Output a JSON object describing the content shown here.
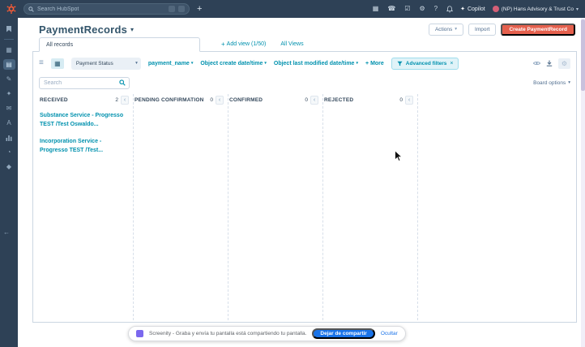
{
  "topbar": {
    "search_placeholder": "Search HubSpot",
    "copilot_label": "Copilot",
    "account_label": "(NP) Hans Advisory & Trust Co"
  },
  "header": {
    "title": "PaymentRecords",
    "actions_label": "Actions",
    "import_label": "Import",
    "create_label": "Create PaymentRecord"
  },
  "views": {
    "active_tab": "All records",
    "add_view_label": "Add view (1/50)",
    "all_views_label": "All Views"
  },
  "toolbar": {
    "pipeline_label": "Payment Status",
    "filter_payment_name": "payment_name",
    "filter_create_date": "Object create date/time",
    "filter_modified_date": "Object last modified date/time",
    "more_label": "More",
    "advanced_filters_label": "Advanced filters"
  },
  "search": {
    "placeholder": "Search"
  },
  "board": {
    "options_label": "Board options",
    "columns": [
      {
        "name": "RECEIVED",
        "count": "2",
        "cards": [
          "Substance Service - Progresso TEST /Test Oswaldo...",
          "Incorporation Service - Progresso TEST /Test..."
        ]
      },
      {
        "name": "PENDING CONFIRMATION",
        "count": "0",
        "cards": []
      },
      {
        "name": "CONFIRMED",
        "count": "0",
        "cards": []
      },
      {
        "name": "REJECTED",
        "count": "0",
        "cards": []
      }
    ]
  },
  "share_bar": {
    "message": "Screenity - Graba y envía tu pantalla está compartiendo tu pantalla.",
    "stop_label": "Dejar de compartir",
    "hide_label": "Ocultar"
  },
  "icons": {
    "plus": "+",
    "caret": "▾",
    "chevron_left": "‹",
    "close": "×",
    "hamburger": "≡",
    "grid": "▦",
    "grid_selected": "▤",
    "marketplace": "▦",
    "phone": "☎",
    "tasks": "☑",
    "gear": "⚙",
    "help": "?",
    "sparkle": "✦",
    "pencil": "✎",
    "mail": "✉",
    "letter_a": "A",
    "pie": "◔",
    "diamond": "◆",
    "arrow_left": "←"
  },
  "colors": {
    "brand_orange": "#ff5c35",
    "create_button": "#e5604d",
    "link_teal": "#0091ae",
    "navy": "#2e4156",
    "share_blue": "#1a73e8"
  }
}
